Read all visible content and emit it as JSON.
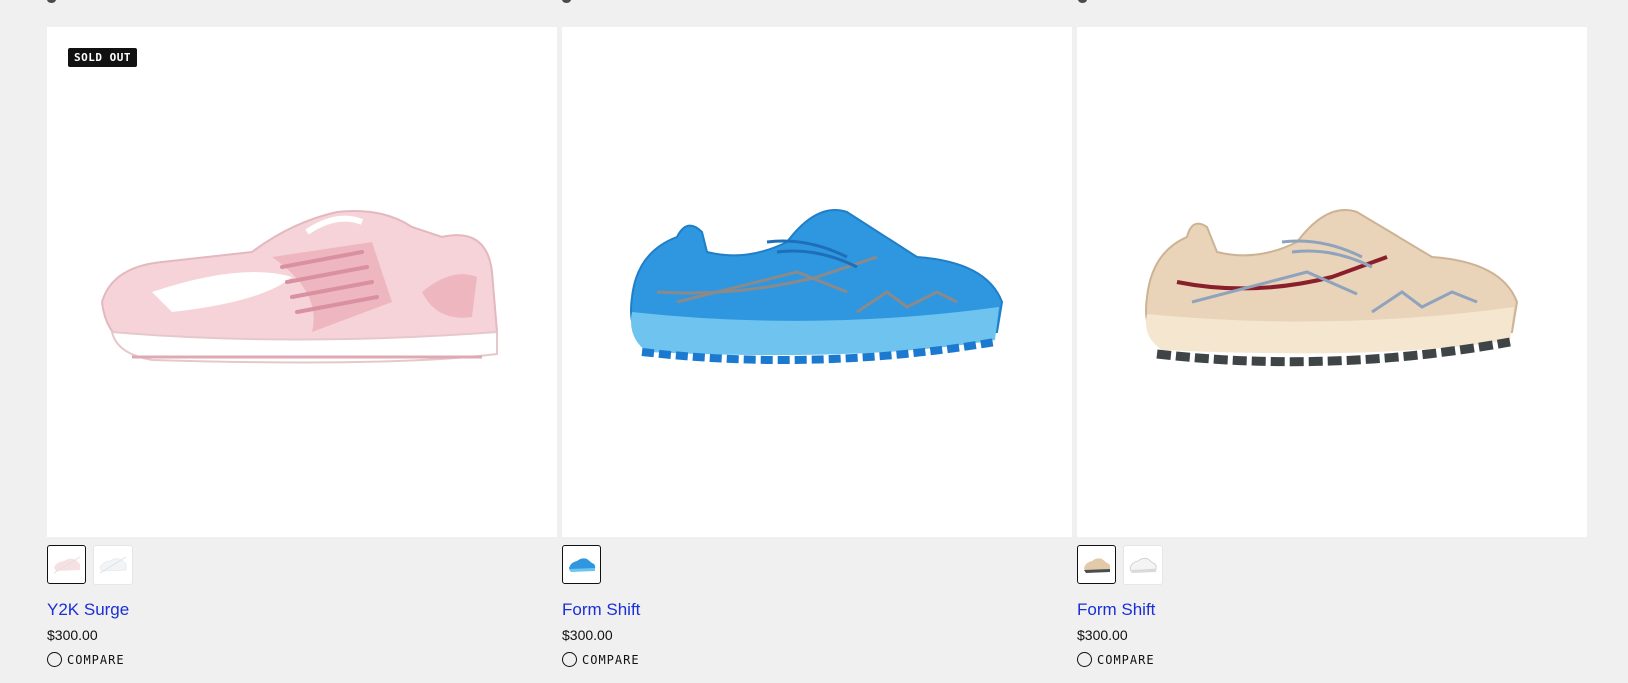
{
  "products": [
    {
      "badge": "SOLD OUT",
      "image_icon": "pink-white-sneaker-icon",
      "name": "Y2K Surge",
      "price": "$300.00",
      "compare_label": "COMPARE",
      "swatches": [
        {
          "icon": "pink-sneaker-swatch-icon",
          "selected": true,
          "disabled": true
        },
        {
          "icon": "white-sneaker-swatch-icon",
          "selected": false,
          "disabled": true
        }
      ]
    },
    {
      "badge": "",
      "image_icon": "blue-trail-shoe-icon",
      "name": "Form Shift",
      "price": "$300.00",
      "compare_label": "COMPARE",
      "swatches": [
        {
          "icon": "blue-shoe-swatch-icon",
          "selected": true,
          "disabled": false
        }
      ]
    },
    {
      "badge": "",
      "image_icon": "tan-trail-shoe-icon",
      "name": "Form Shift",
      "price": "$300.00",
      "compare_label": "COMPARE",
      "swatches": [
        {
          "icon": "tan-shoe-swatch-icon",
          "selected": true,
          "disabled": false
        },
        {
          "icon": "white-shoe-swatch-icon",
          "selected": false,
          "disabled": false
        }
      ]
    }
  ],
  "colors": {
    "page_background": "#f0f0f0",
    "link": "#1a2fd6",
    "badge_background": "#111111"
  }
}
